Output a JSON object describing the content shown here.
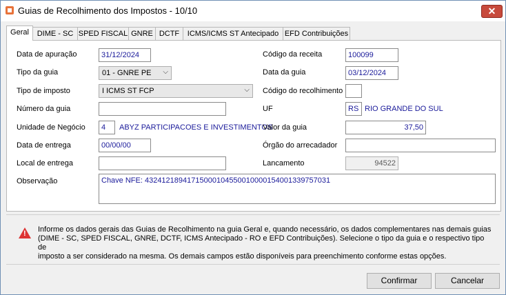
{
  "window": {
    "title": "Guias de Recolhimento dos Impostos - 10/10",
    "close_label": "✕"
  },
  "tabs": [
    "Geral",
    "DIME - SC",
    "SPED FISCAL",
    "GNRE",
    "DCTF",
    "ICMS/ICMS ST Antecipado",
    "EFD Contribuições"
  ],
  "form": {
    "data_apuracao": {
      "label": "Data de apuração",
      "value": "31/12/2024"
    },
    "tipo_guia": {
      "label": "Tipo da guia",
      "value": "01 - GNRE PE"
    },
    "tipo_imposto": {
      "label": "Tipo de imposto",
      "value": "I ICMS ST FCP"
    },
    "numero_guia": {
      "label": "Número da guia",
      "value": ""
    },
    "unidade_negocio": {
      "label": "Unidade de Negócio",
      "code": "4",
      "name": "ABYZ PARTICIPACOES E INVESTIMENTOS"
    },
    "data_entrega": {
      "label": "Data de entrega",
      "value": "00/00/00"
    },
    "local_entrega": {
      "label": "Local de entrega",
      "value": ""
    },
    "codigo_receita": {
      "label": "Código da receita",
      "value": "100099"
    },
    "data_guia": {
      "label": "Data da guia",
      "value": "03/12/2024"
    },
    "codigo_recolhimento": {
      "label": "Código do recolhimento",
      "value": ""
    },
    "uf": {
      "label": "UF",
      "code": "RS",
      "name": "RIO GRANDE DO SUL"
    },
    "valor_guia": {
      "label": "Valor da guia",
      "value": "37,50"
    },
    "orgao_arrecadador": {
      "label": "Órgão do arrecadador",
      "value": ""
    },
    "lancamento": {
      "label": "Lancamento",
      "value": "94522"
    },
    "observacao": {
      "label": "Observação",
      "value": "Chave NFE: 43241218941715000104550010000154001339757031"
    }
  },
  "warning": {
    "line1": "Informe os dados gerais das Guias de Recolhimento na guia Geral e, quando necessário, os dados complementares nas demais guias",
    "line2": "(DIME - SC, SPED FISCAL, GNRE, DCTF, ICMS Antecipado - RO e EFD Contribuições). Selecione o tipo da guia e o respectivo tipo de",
    "line3": "imposto a ser considerado na mesma. Os demais campos estão disponíveis para preenchimento conforme estas opções."
  },
  "buttons": {
    "confirm": "Confirmar",
    "cancel": "Cancelar"
  }
}
